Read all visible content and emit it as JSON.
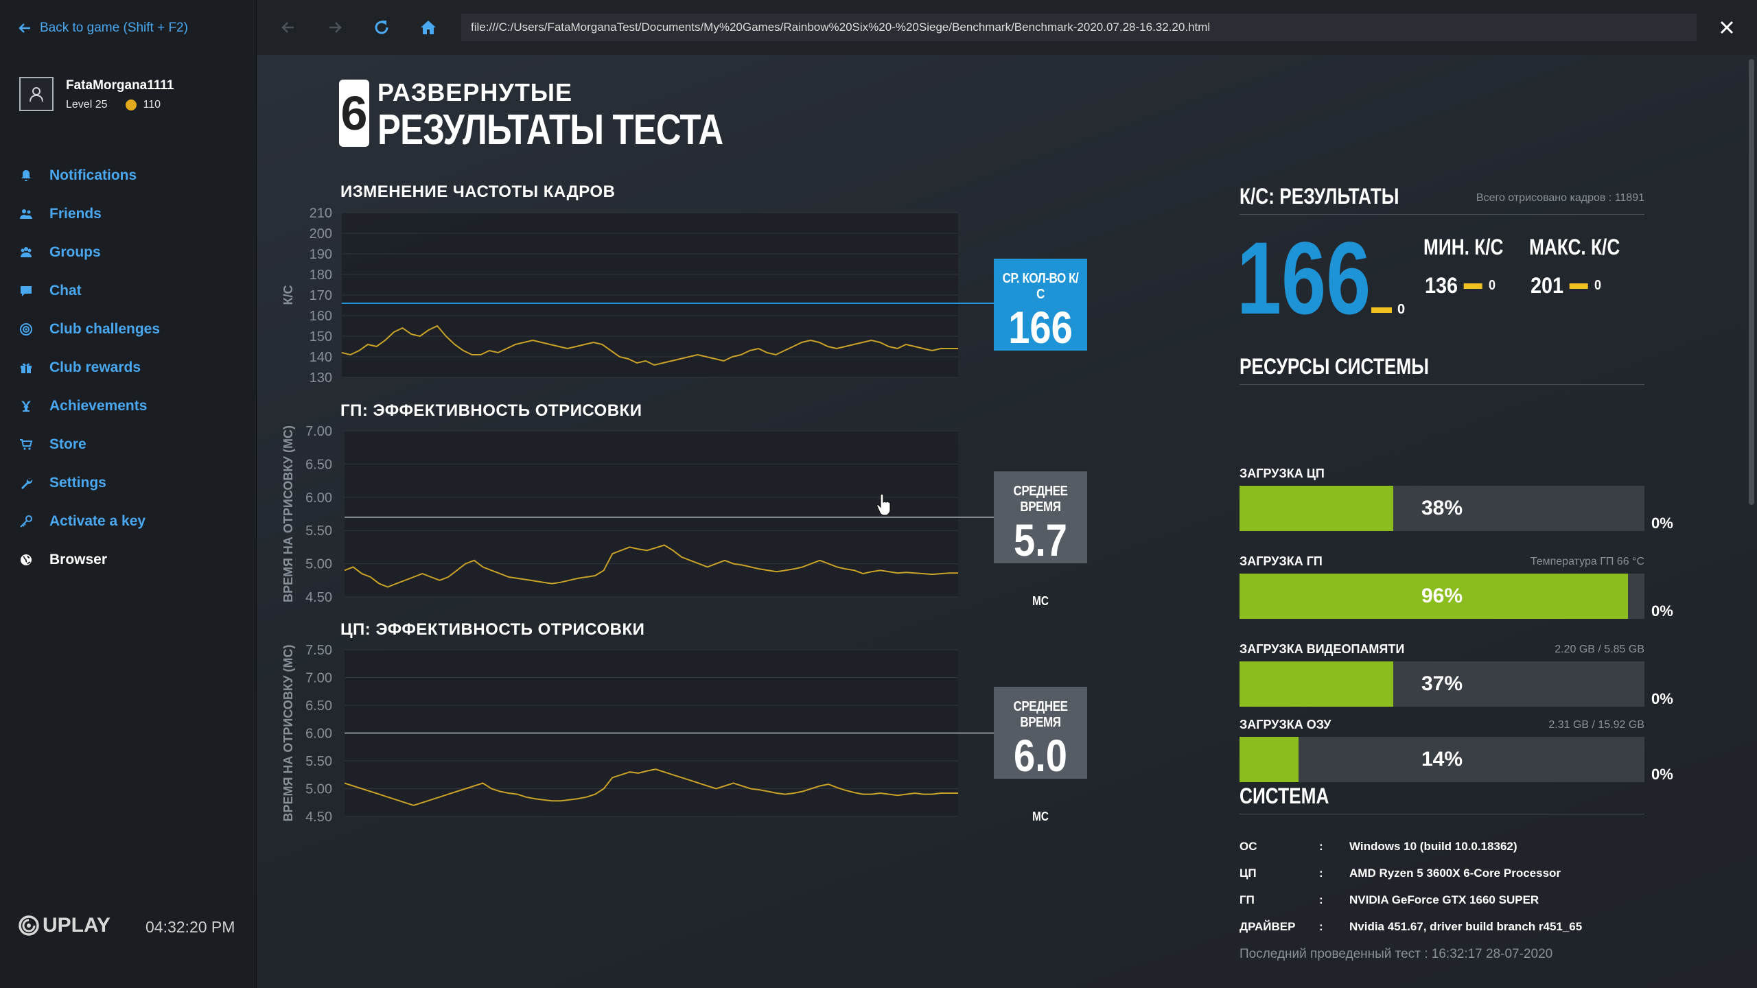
{
  "sidebar": {
    "back_label": "Back to game (Shift + F2)",
    "user": {
      "name": "FataMorgana1111",
      "level": "Level 25",
      "coins": "110"
    },
    "items": [
      {
        "label": "Notifications",
        "icon": "bell-icon"
      },
      {
        "label": "Friends",
        "icon": "friends-icon"
      },
      {
        "label": "Groups",
        "icon": "groups-icon"
      },
      {
        "label": "Chat",
        "icon": "chat-icon"
      },
      {
        "label": "Club challenges",
        "icon": "target-icon"
      },
      {
        "label": "Club rewards",
        "icon": "gift-icon"
      },
      {
        "label": "Achievements",
        "icon": "trophy-icon"
      },
      {
        "label": "Store",
        "icon": "cart-icon"
      },
      {
        "label": "Settings",
        "icon": "wrench-icon"
      },
      {
        "label": "Activate a key",
        "icon": "key-icon"
      },
      {
        "label": "Browser",
        "icon": "globe-icon"
      }
    ],
    "brand": "UPLAY",
    "clock": "04:32:20 PM"
  },
  "browser": {
    "url": "file:///C:/Users/FataMorganaTest/Documents/My%20Games/Rainbow%20Six%20-%20Siege/Benchmark/Benchmark-2020.07.28-16.32.20.html"
  },
  "page": {
    "logo": "6",
    "title_line1": "РАЗВЕРНУТЫЕ",
    "title_line2": "РЕЗУЛЬТАТЫ ТЕСТА"
  },
  "chart_data": [
    {
      "type": "line",
      "title": "ИЗМЕНЕНИЕ ЧАСТОТЫ КАДРОВ",
      "ylabel": "К/С",
      "ylim": [
        130,
        210
      ],
      "yticks": [
        "210",
        "200",
        "190",
        "180",
        "170",
        "160",
        "150",
        "140",
        "130"
      ],
      "average": 166,
      "average_label": "СР. КОЛ-ВО К/С",
      "average_text": "166",
      "unit": "",
      "series": [
        {
          "values": [
            142,
            141,
            143,
            146,
            145,
            148,
            152,
            154,
            151,
            150,
            153,
            155,
            150,
            146,
            143,
            141,
            141,
            143,
            142,
            144,
            146,
            147,
            148,
            147,
            146,
            145,
            144,
            145,
            146,
            147,
            146,
            143,
            140,
            139,
            137,
            138,
            136,
            137,
            138,
            139,
            140,
            141,
            140,
            139,
            138,
            140,
            141,
            143,
            144,
            142,
            141,
            143,
            145,
            147,
            148,
            147,
            145,
            144,
            145,
            146,
            147,
            148,
            147,
            145,
            144,
            146,
            145,
            144,
            143,
            144,
            144,
            144
          ]
        }
      ],
      "grid": true
    },
    {
      "type": "line",
      "title": "ГП: ЭФФЕКТИВНОСТЬ ОТРИСОВКИ",
      "ylabel": "ВРЕМЯ НА ОТРИСОВКУ (МС)",
      "ylim": [
        4.5,
        7.0
      ],
      "yticks": [
        "7.00",
        "6.50",
        "6.00",
        "5.50",
        "5.00",
        "4.50"
      ],
      "average": 5.7,
      "average_label": "СРЕДНЕЕ ВРЕМЯ",
      "average_text": "5.7",
      "unit": "МС",
      "series": [
        {
          "values": [
            4.9,
            4.95,
            4.85,
            4.8,
            4.7,
            4.65,
            4.7,
            4.75,
            4.8,
            4.85,
            4.8,
            4.75,
            4.8,
            4.9,
            5.0,
            5.05,
            4.95,
            4.9,
            4.85,
            4.8,
            4.78,
            4.76,
            4.74,
            4.72,
            4.7,
            4.72,
            4.75,
            4.78,
            4.8,
            4.82,
            4.9,
            5.15,
            5.2,
            5.25,
            5.22,
            5.2,
            5.24,
            5.28,
            5.2,
            5.1,
            5.05,
            5.0,
            4.95,
            5.0,
            5.05,
            5.0,
            4.98,
            4.95,
            4.92,
            4.9,
            4.88,
            4.9,
            4.92,
            4.95,
            5.0,
            5.05,
            5.0,
            4.95,
            4.92,
            4.9,
            4.85,
            4.88,
            4.9,
            4.88,
            4.86,
            4.87,
            4.86,
            4.85,
            4.84,
            4.85,
            4.86,
            4.86
          ]
        }
      ],
      "grid": true
    },
    {
      "type": "line",
      "title": "ЦП: ЭФФЕКТИВНОСТЬ ОТРИСОВКИ",
      "ylabel": "ВРЕМЯ НА ОТРИСОВКУ (МС)",
      "ylim": [
        4.5,
        7.5
      ],
      "yticks": [
        "7.50",
        "7.00",
        "6.50",
        "6.00",
        "5.50",
        "5.00",
        "4.50"
      ],
      "average": 6.0,
      "average_label": "СРЕДНЕЕ ВРЕМЯ",
      "average_text": "6.0",
      "unit": "МС",
      "series": [
        {
          "values": [
            5.1,
            5.05,
            5.0,
            4.95,
            4.9,
            4.85,
            4.8,
            4.75,
            4.7,
            4.75,
            4.8,
            4.85,
            4.9,
            4.95,
            5.0,
            5.05,
            5.1,
            5.0,
            4.95,
            4.92,
            4.9,
            4.85,
            4.82,
            4.8,
            4.78,
            4.78,
            4.8,
            4.82,
            4.85,
            4.9,
            5.0,
            5.2,
            5.25,
            5.3,
            5.28,
            5.32,
            5.35,
            5.3,
            5.25,
            5.2,
            5.15,
            5.1,
            5.05,
            5.0,
            5.05,
            5.1,
            5.05,
            5.0,
            4.98,
            4.95,
            4.92,
            4.9,
            4.92,
            4.95,
            5.0,
            5.05,
            5.08,
            5.02,
            4.97,
            4.93,
            4.9,
            4.9,
            4.92,
            4.9,
            4.88,
            4.9,
            4.92,
            4.9,
            4.9,
            4.92,
            4.92,
            4.92
          ]
        }
      ],
      "grid": true
    }
  ],
  "fps_results": {
    "heading": "К/С: РЕЗУЛЬТАТЫ",
    "frames_total": "Всего отрисовано кадров : 11891",
    "avg": "166",
    "avg_drops": "0",
    "min_label": "МИН. К/С",
    "min": "136",
    "min_drops": "0",
    "max_label": "МАКС. К/С",
    "max": "201",
    "max_drops": "0"
  },
  "resources": {
    "heading": "РЕСУРСЫ СИСТЕМЫ",
    "items": [
      {
        "label": "ЗАГРУЗКА ЦП",
        "note": "",
        "pct_text": "38%",
        "fill": 0.38,
        "zero": "0%"
      },
      {
        "label": "ЗАГРУЗКА ГП",
        "note": "Температура ГП 66 °C",
        "pct_text": "96%",
        "fill": 0.96,
        "zero": "0%"
      },
      {
        "label": "ЗАГРУЗКА ВИДЕОПАМЯТИ",
        "note": "2.20 GB / 5.85 GB",
        "pct_text": "37%",
        "fill": 0.38,
        "zero": "0%"
      },
      {
        "label": "ЗАГРУЗКА ОЗУ",
        "note": "2.31 GB / 15.92 GB",
        "pct_text": "14%",
        "fill": 0.145,
        "zero": "0%"
      }
    ]
  },
  "system": {
    "heading": "СИСТЕМА",
    "rows": [
      {
        "key": "ОС",
        "sep": ":",
        "value": "Windows 10 (build 10.0.18362)"
      },
      {
        "key": "ЦП",
        "sep": ":",
        "value": "AMD Ryzen 5 3600X 6-Core Processor"
      },
      {
        "key": "ГП",
        "sep": ":",
        "value": "NVIDIA GeForce GTX 1660 SUPER"
      },
      {
        "key": "ДРАЙВЕР",
        "sep": ":",
        "value": "Nvidia 451.67, driver build branch r451_65"
      }
    ],
    "last_test": "Последний проведенный тест : 16:32:17 28-07-2020"
  },
  "colors": {
    "accent": "#1e94d6",
    "link": "#4aa8f0",
    "bar_green": "#8bbd1e",
    "line_yellow": "#c9a227",
    "drop_yellow": "#f0c020"
  }
}
